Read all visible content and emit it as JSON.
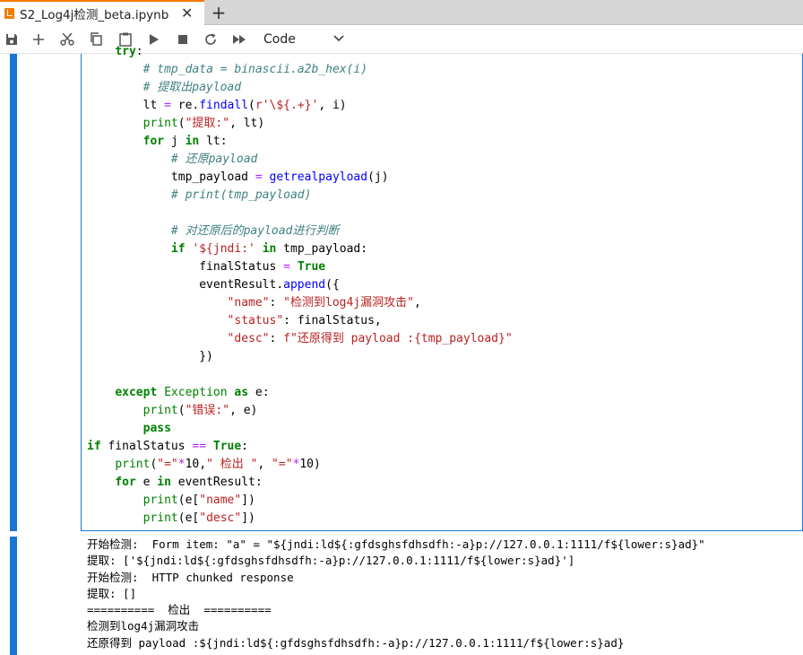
{
  "tab": {
    "title": "S2_Log4j检测_beta.ipynb",
    "close": "✕",
    "add": "+"
  },
  "toolbar": {
    "cell_type": "Code"
  },
  "code_lines": [
    [
      "    try:"
    ],
    [
      "        # tmp_data = binascii.a2b_hex(i)"
    ],
    [
      "        # 提取出payload"
    ],
    [
      "        lt = re.findall(r'\\${.+}', i)"
    ],
    [
      "        print(\"提取:\", lt)"
    ],
    [
      "        for j in lt:"
    ],
    [
      "            # 还原payload"
    ],
    [
      "            tmp_payload = getrealpayload(j)"
    ],
    [
      "            # print(tmp_payload)"
    ],
    [
      ""
    ],
    [
      "            # 对还原后的payload进行判断"
    ],
    [
      "            if '${jndi:' in tmp_payload:"
    ],
    [
      "                finalStatus = True"
    ],
    [
      "                eventResult.append({"
    ],
    [
      "                    \"name\": \"检测到log4j漏洞攻击\","
    ],
    [
      "                    \"status\": finalStatus,"
    ],
    [
      "                    \"desc\": f\"还原得到 payload :{tmp_payload}\""
    ],
    [
      "                })"
    ],
    [
      ""
    ],
    [
      "    except Exception as e:"
    ],
    [
      "        print(\"错误:\", e)"
    ],
    [
      "        pass"
    ],
    [
      "if finalStatus == True:"
    ],
    [
      "    print(\"=\"*10,\" 检出 \", \"=\"*10)"
    ],
    [
      "    for e in eventResult:"
    ],
    [
      "        print(e[\"name\"])"
    ],
    [
      "        print(e[\"desc\"])"
    ]
  ],
  "output_lines": [
    "开始检测:  Form item: \"a\" = \"${jndi:ld${:gfdsghsfdhsdfh:-a}p://127.0.0.1:1111/f${lower:s}ad}\"",
    "提取: ['${jndi:ld${:gfdsghsfdhsdfh:-a}p://127.0.0.1:1111/f${lower:s}ad}']",
    "开始检测:  HTTP chunked response",
    "提取: []",
    "==========  检出  ==========",
    "检测到log4j漏洞攻击",
    "还原得到 payload :${jndi:ld${:gfdsghsfdhsdfh:-a}p://127.0.0.1:1111/f${lower:s}ad}"
  ]
}
